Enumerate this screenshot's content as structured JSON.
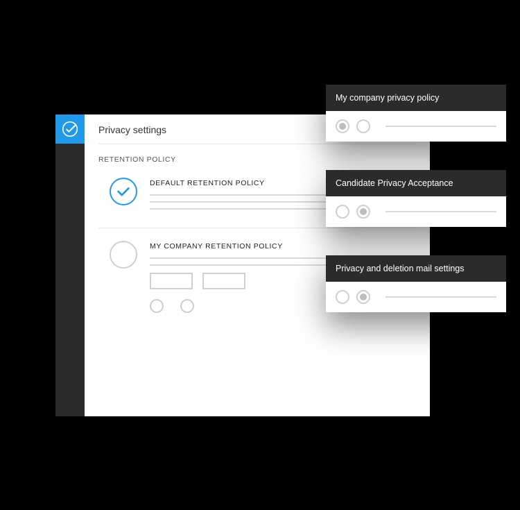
{
  "page": {
    "title": "Privacy settings",
    "section_label": "RETENTION POLICY",
    "options": [
      {
        "title": "DEFAULT RETENTION POLICY",
        "selected": true
      },
      {
        "title": "MY COMPANY RETENTION POLICY",
        "selected": false
      }
    ]
  },
  "cards": [
    {
      "title": "My company privacy policy",
      "radio_selected_index": 0
    },
    {
      "title": "Candidate Privacy Acceptance",
      "radio_selected_index": 1
    },
    {
      "title": "Privacy and deletion mail settings",
      "radio_selected_index": 1
    }
  ],
  "colors": {
    "accent": "#2199e8",
    "dark": "#2b2b2b"
  },
  "icons": {
    "logo": "check-circle-logo",
    "selected": "check-icon"
  }
}
